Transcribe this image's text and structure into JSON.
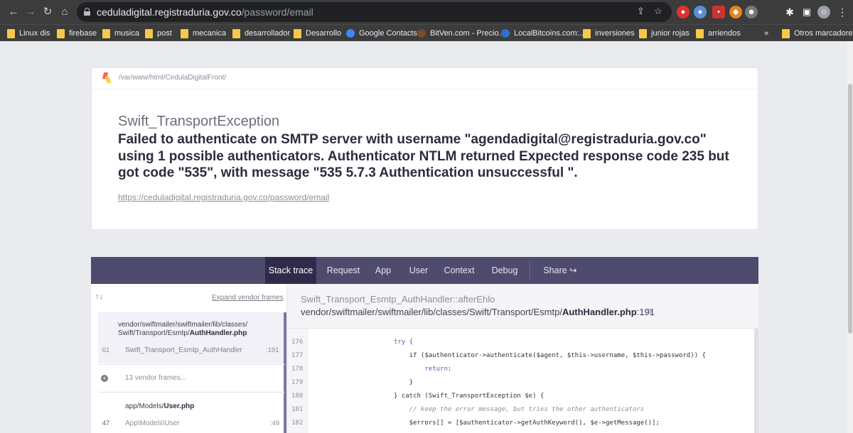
{
  "browser": {
    "url_host": "ceduladigital.registraduria.gov.co",
    "url_path": "/password/email",
    "bookmarks": [
      "Linux dis",
      "firebase",
      "musica",
      "post",
      "mecanica",
      "desarrollador",
      "Desarrollo",
      "Google Contacts",
      "BitVen.com - Precio...",
      "LocalBitcoins.com:...",
      "inversiones",
      "junior rojas",
      "arriendos",
      "»",
      "Otros marcadores"
    ]
  },
  "error": {
    "project_path": "/var/www/html/CedulaDigitalFront/",
    "exception_class": "Swift_TransportException",
    "message": "Failed to authenticate on SMTP server with username \"agendadigital@registraduria.gov.co\" using 1 possible authenticators. Authenticator NTLM returned Expected response code 235 but got code \"535\", with message \"535 5.7.3 Authentication unsuccessful \".",
    "request_url": "https://ceduladigital.registraduria.gov.co/password/email"
  },
  "tabs": [
    "Stack trace",
    "Request",
    "App",
    "User",
    "Context",
    "Debug",
    "Share"
  ],
  "stack": {
    "arrows": "↑↓",
    "expand_label": "Expand vendor frames",
    "frame1_file_line1": "vendor/swiftmailer/swiftmailer/lib/classes/",
    "frame1_file_line2_prefix": "Swift/Transport/Esmtp/",
    "frame1_file_line2_bold": "AuthHandler.php",
    "frame1_num": "61",
    "frame1_class": "Swift_Transport_Esmtp_AuthHandler",
    "frame1_line": ":191",
    "vendor_frames": "13 vendor frames...",
    "frame2_file_prefix": "app/Models/",
    "frame2_file_bold": "User.php",
    "frame2_num": "47",
    "frame2_class": "App\\Models\\User",
    "frame2_line": ":49"
  },
  "code": {
    "class_method": "Swift_Transport_Esmtp_AuthHandler::afterEhlo",
    "file_prefix": "vendor/swiftmailer/swiftmailer/lib/classes/Swift/Transport/Esmtp/",
    "file_bold": "AuthHandler.php",
    "line_suffix": ":191",
    "line_numbers": [
      "176",
      "177",
      "178",
      "179",
      "180",
      "181",
      "182"
    ],
    "lines": [
      "try {",
      "    if ($authenticator->authenticate($agent, $this->username, $this->password)) {",
      "        return;",
      "    }",
      "} catch (Swift_TransportException $e) {",
      "    // keep the error message, but tries the other authenticators",
      "    $errors[] = [$authenticator->getAuthKeyword(), $e->getMessage()];"
    ]
  },
  "colors": {
    "tab_bar": "#4e4b6e",
    "tab_active": "#2f2c4b",
    "frame_highlight": "#f2f1f7"
  }
}
